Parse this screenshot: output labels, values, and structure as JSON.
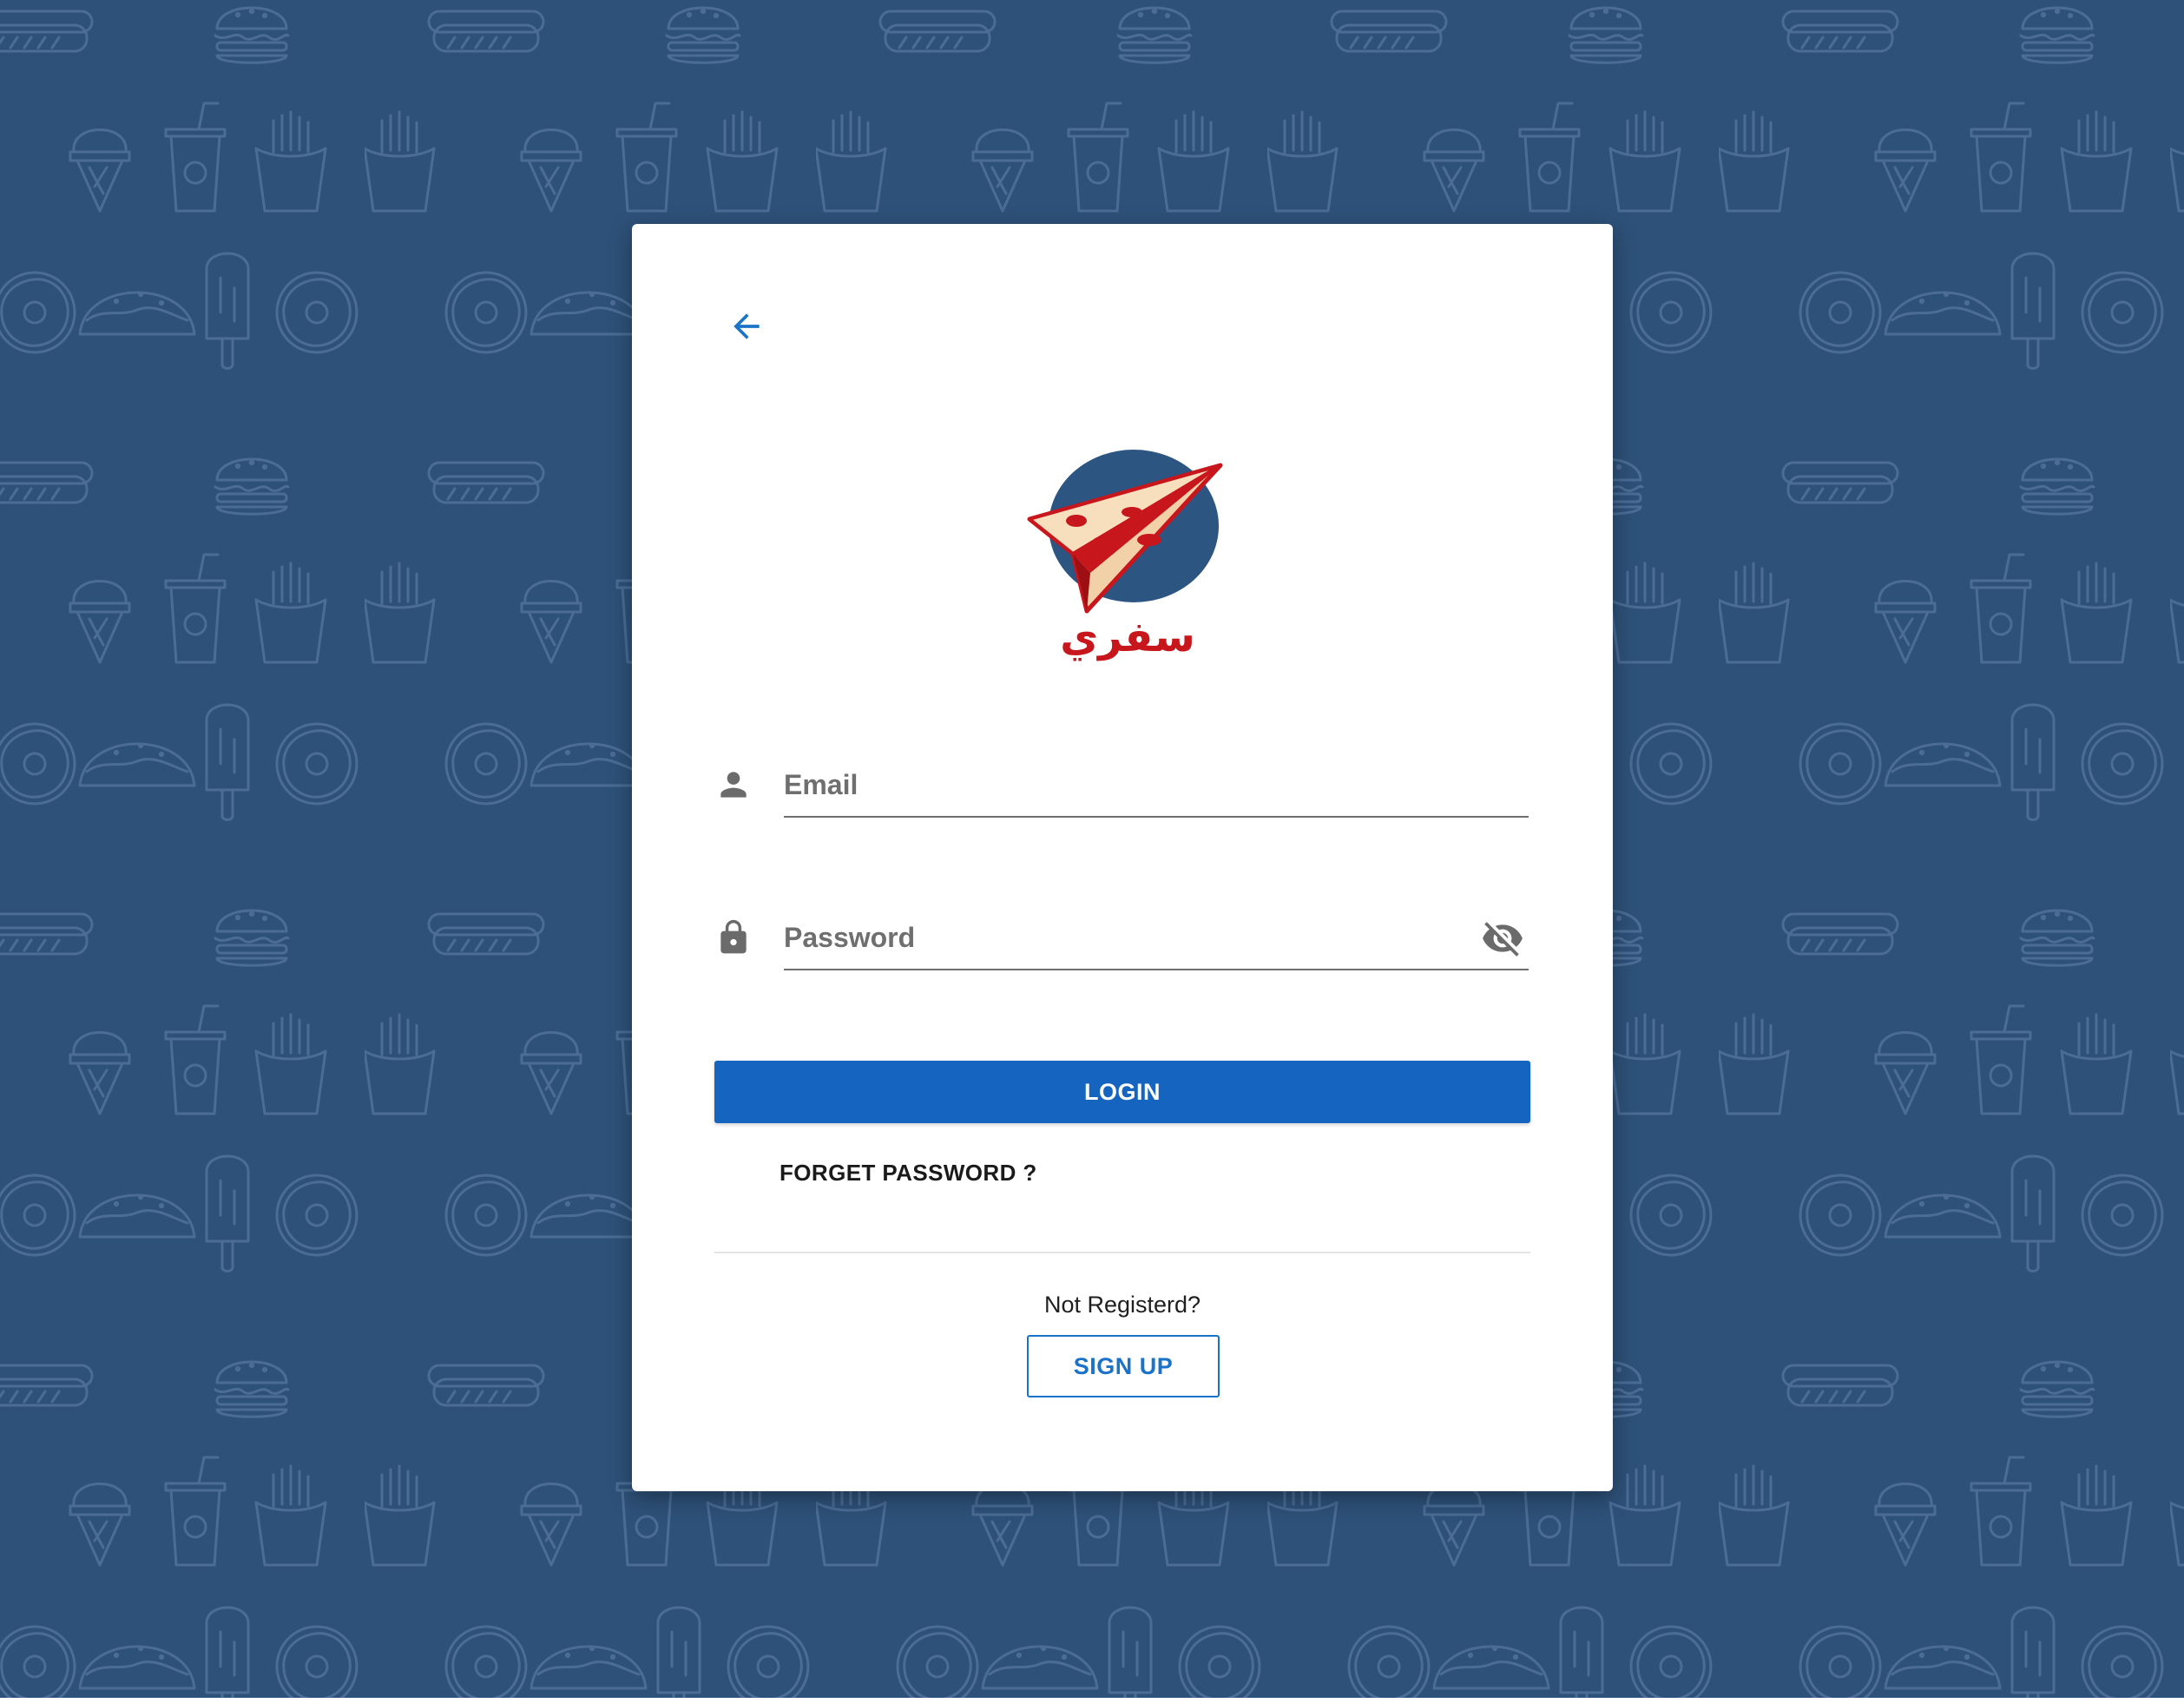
{
  "background": {
    "color": "#2e5179",
    "pattern_icons": [
      "burger-icon",
      "hotdog-icon",
      "french-fries-icon",
      "ice-cream-cone-icon",
      "soda-cup-icon",
      "donut-icon",
      "taco-icon",
      "popsicle-icon"
    ]
  },
  "card": {
    "back_icon": "arrow-left-icon",
    "logo": {
      "text": "سفري",
      "icon": "paper-plane-pizza-logo",
      "colors": [
        "#2d5582",
        "#c8161d",
        "#f2d0a8"
      ]
    },
    "email": {
      "placeholder": "Email",
      "value": "",
      "icon": "person-icon"
    },
    "password": {
      "placeholder": "Password",
      "value": "",
      "icon": "lock-icon",
      "toggle_icon": "eye-off-icon"
    },
    "login_label": "LOGIN",
    "forget_label": "FORGET PASSWORD ?",
    "not_registered": "Not Registerd?",
    "signup_label": "SIGN UP"
  },
  "colors": {
    "primary": "#1565c0",
    "accent": "#1a73c8",
    "icon_gray": "#6b6b6b"
  }
}
